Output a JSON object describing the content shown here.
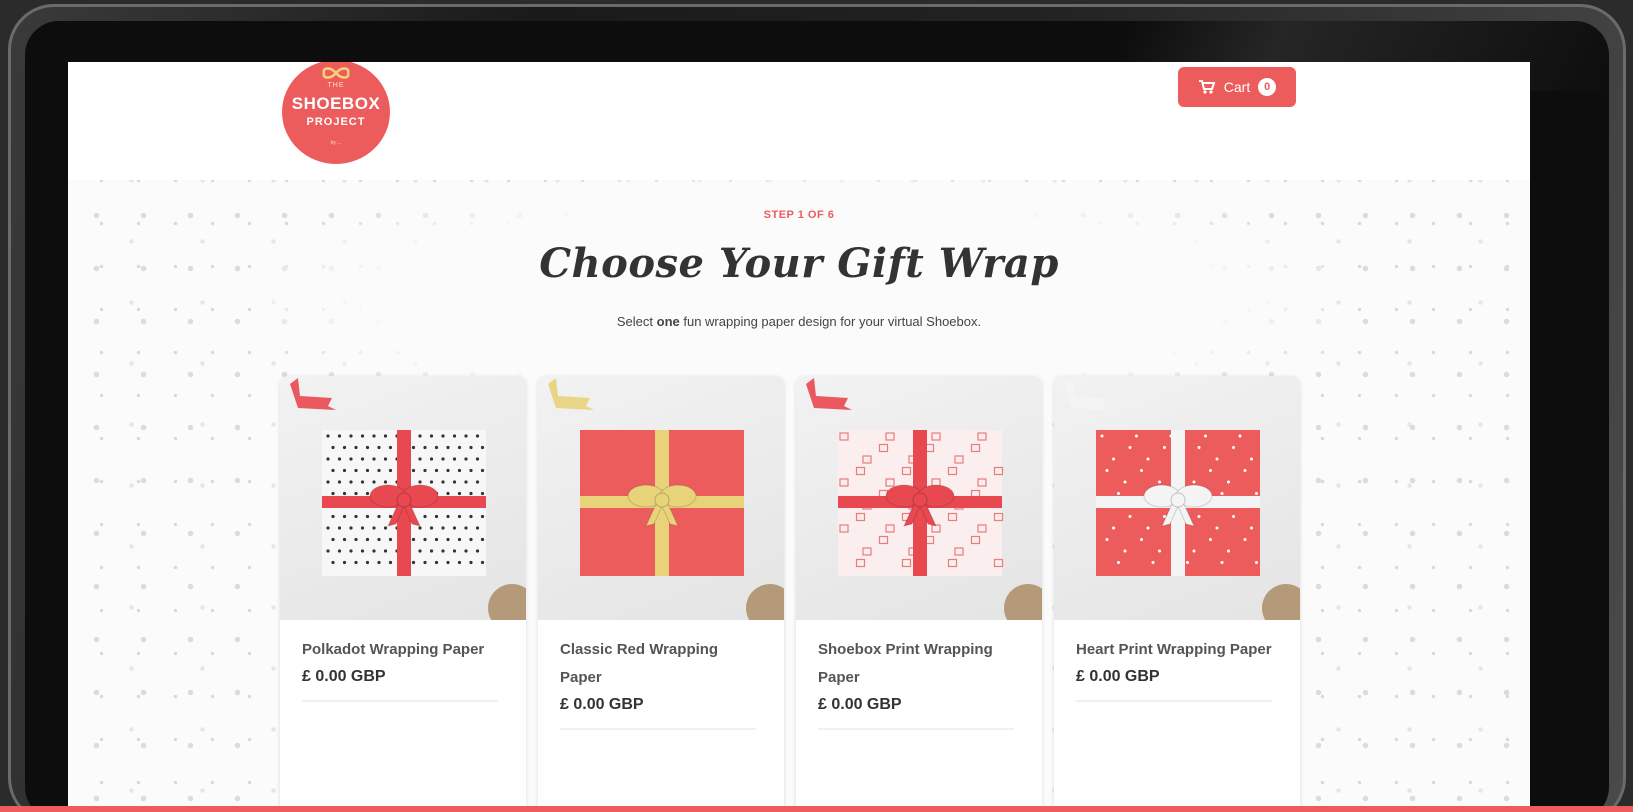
{
  "header": {
    "logo": {
      "small_top": "THE",
      "name": "SHOEBOX",
      "project": "PROJECT",
      "small_bottom": "by ..."
    },
    "cart": {
      "label": "Cart",
      "count": "0"
    }
  },
  "main": {
    "step": "STEP 1 OF 6",
    "title": "Choose Your Gift Wrap",
    "subtitle_before": "Select ",
    "subtitle_bold": "one",
    "subtitle_after": " fun wrapping paper design for your virtual Shoebox."
  },
  "products": [
    {
      "name": "Polkadot Wrapping Paper",
      "price": "£ 0.00 GBP",
      "paper_color": "#f7f7f7",
      "ribbon_color": "#e8484f",
      "pattern": "polkadot"
    },
    {
      "name": "Classic Red Wrapping Paper",
      "price": "£ 0.00 GBP",
      "paper_color": "#ec5c5c",
      "ribbon_color": "#e8d27a",
      "pattern": "plain"
    },
    {
      "name": "Shoebox Print Wrapping Paper",
      "price": "£ 0.00 GBP",
      "paper_color": "#fbeeee",
      "ribbon_color": "#e8484f",
      "pattern": "shoebox"
    },
    {
      "name": "Heart Print Wrapping Paper",
      "price": "£ 0.00 GBP",
      "paper_color": "#ec5c5c",
      "ribbon_color": "#f4f4f4",
      "pattern": "hearts"
    }
  ],
  "colors": {
    "accent": "#ec5c5c",
    "text_dark": "#333333"
  }
}
